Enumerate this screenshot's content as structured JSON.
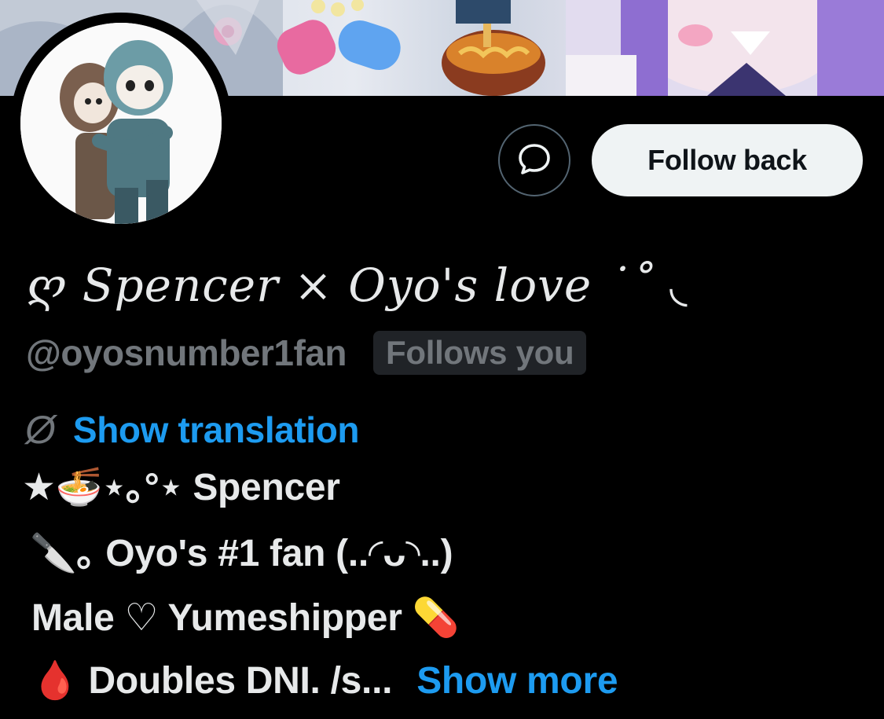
{
  "profile": {
    "display_name": "ღ Spencer × Oyo's love ˙˚ ◟",
    "handle": "@oyosnumber1fan",
    "follows_you_badge": "Follows you"
  },
  "actions": {
    "message_icon": "message-bubble-icon",
    "follow_label": "Follow back"
  },
  "translation": {
    "icon": "translate-slash-icon",
    "label": "Show translation"
  },
  "bio": {
    "line1": "★🍜⋆｡°⋆ Spencer",
    "line2": "🔪｡  Oyo's #1 fan (..◜ᴗ◝..)",
    "line3": "Male ♡ Yumeshipper 💊",
    "line4_text": "🩸 Doubles DNI. /s...",
    "line4_link": "Show more"
  },
  "colors": {
    "background": "#000000",
    "text": "#e7e9ea",
    "muted": "#71767b",
    "link": "#1d9bf0",
    "button_bg": "#eff3f4",
    "badge_bg": "#202327"
  }
}
